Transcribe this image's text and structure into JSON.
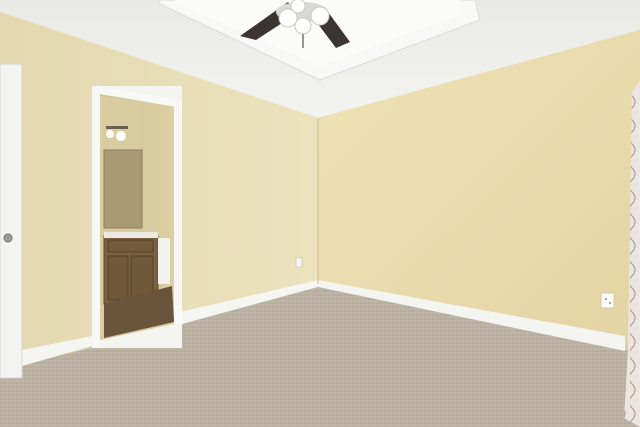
{
  "scene": {
    "subject": "empty-bedroom-interior",
    "colors": {
      "ceiling": "#efefec",
      "tray_ceiling": "#f7f7f5",
      "left_wall": "#e6dbb4",
      "back_wall": "#eadcae",
      "baseboard": "#f4f4f1",
      "carpet": "#bcb2a4",
      "door": "#f3f3f2",
      "vanity_wood": "#7a6140",
      "bathroom_floor": "#6a543c",
      "fan_blade": "#3b3430"
    },
    "icons": [
      "ceiling-fan-icon",
      "door-knob-icon",
      "outlet-icon",
      "vanity-light-icon"
    ]
  }
}
